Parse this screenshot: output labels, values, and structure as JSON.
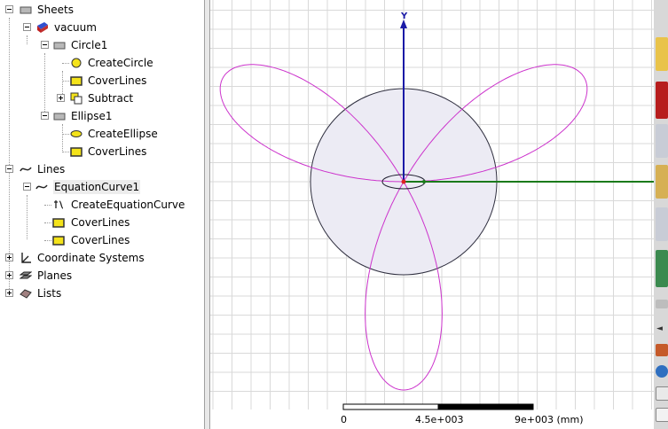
{
  "tree": {
    "sheets_label": "Sheets",
    "vacuum_label": "vacuum",
    "circle1_label": "Circle1",
    "create_circle_label": "CreateCircle",
    "coverlines_circle_label": "CoverLines",
    "subtract_label": "Subtract",
    "ellipse1_label": "Ellipse1",
    "create_ellipse_label": "CreateEllipse",
    "coverlines_ellipse_label": "CoverLines",
    "lines_label": "Lines",
    "equation_curve1_label": "EquationCurve1",
    "create_equation_curve_label": "CreateEquationCurve",
    "coverlines_curve_a_label": "CoverLines",
    "coverlines_curve_b_label": "CoverLines",
    "coordinate_systems_label": "Coordinate Systems",
    "planes_label": "Planes",
    "lists_label": "Lists"
  },
  "viewport": {
    "axis_y_label": "Y",
    "scale_label_0": "0",
    "scale_label_mid": "4.5e+003",
    "scale_label_max": "9e+003 (mm)",
    "colors": {
      "grid": "#d9d9d9",
      "y_axis": "#1a1aa6",
      "x_axis": "#1a7a1a",
      "curve": "#cc33cc",
      "circle_fill": "#ecebf4",
      "circle_stroke": "#2f2f3f"
    }
  },
  "right_toolbar": {
    "icons": [
      "folder-icon",
      "magnet-icon",
      "toolbar-icon",
      "toolbar-icon",
      "toolbar-icon",
      "toolbar-icon",
      "toolbar-icon",
      "arrow-icon",
      "toolbar-icon",
      "globe-icon",
      "toolbar-icon",
      "toolbar-icon"
    ]
  }
}
